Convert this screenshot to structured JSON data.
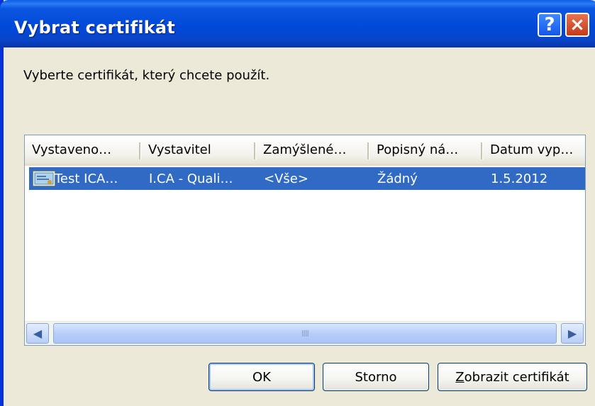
{
  "window": {
    "title": "Vybrat certifikát",
    "help_glyph": "?",
    "close_glyph": "×"
  },
  "prompt": "Vyberte certifikát, který chcete použít.",
  "columns": [
    "Vystaveno…",
    "Vystavitel",
    "Zamýšlené…",
    "Popisný ná…",
    "Datum vyp…"
  ],
  "rows": [
    {
      "issued_to": "Test ICA…",
      "issuer": "I.CA - Quali…",
      "purposes": "<Vše>",
      "friendly_name": "Žádný",
      "expiration": "1.5.2012",
      "selected": true,
      "icon": "certificate-icon"
    }
  ],
  "scrollbar": {
    "left_arrow": "◀",
    "right_arrow": "▶",
    "thumb_grip": "IIII"
  },
  "buttons": {
    "ok": "OK",
    "cancel": "Storno",
    "view_underlined": "Z",
    "view_rest": "obrazit certifikát"
  },
  "colors": {
    "titlebar": "#0048d8",
    "selection": "#316ac5",
    "dialog_bg": "#ece9d8"
  }
}
